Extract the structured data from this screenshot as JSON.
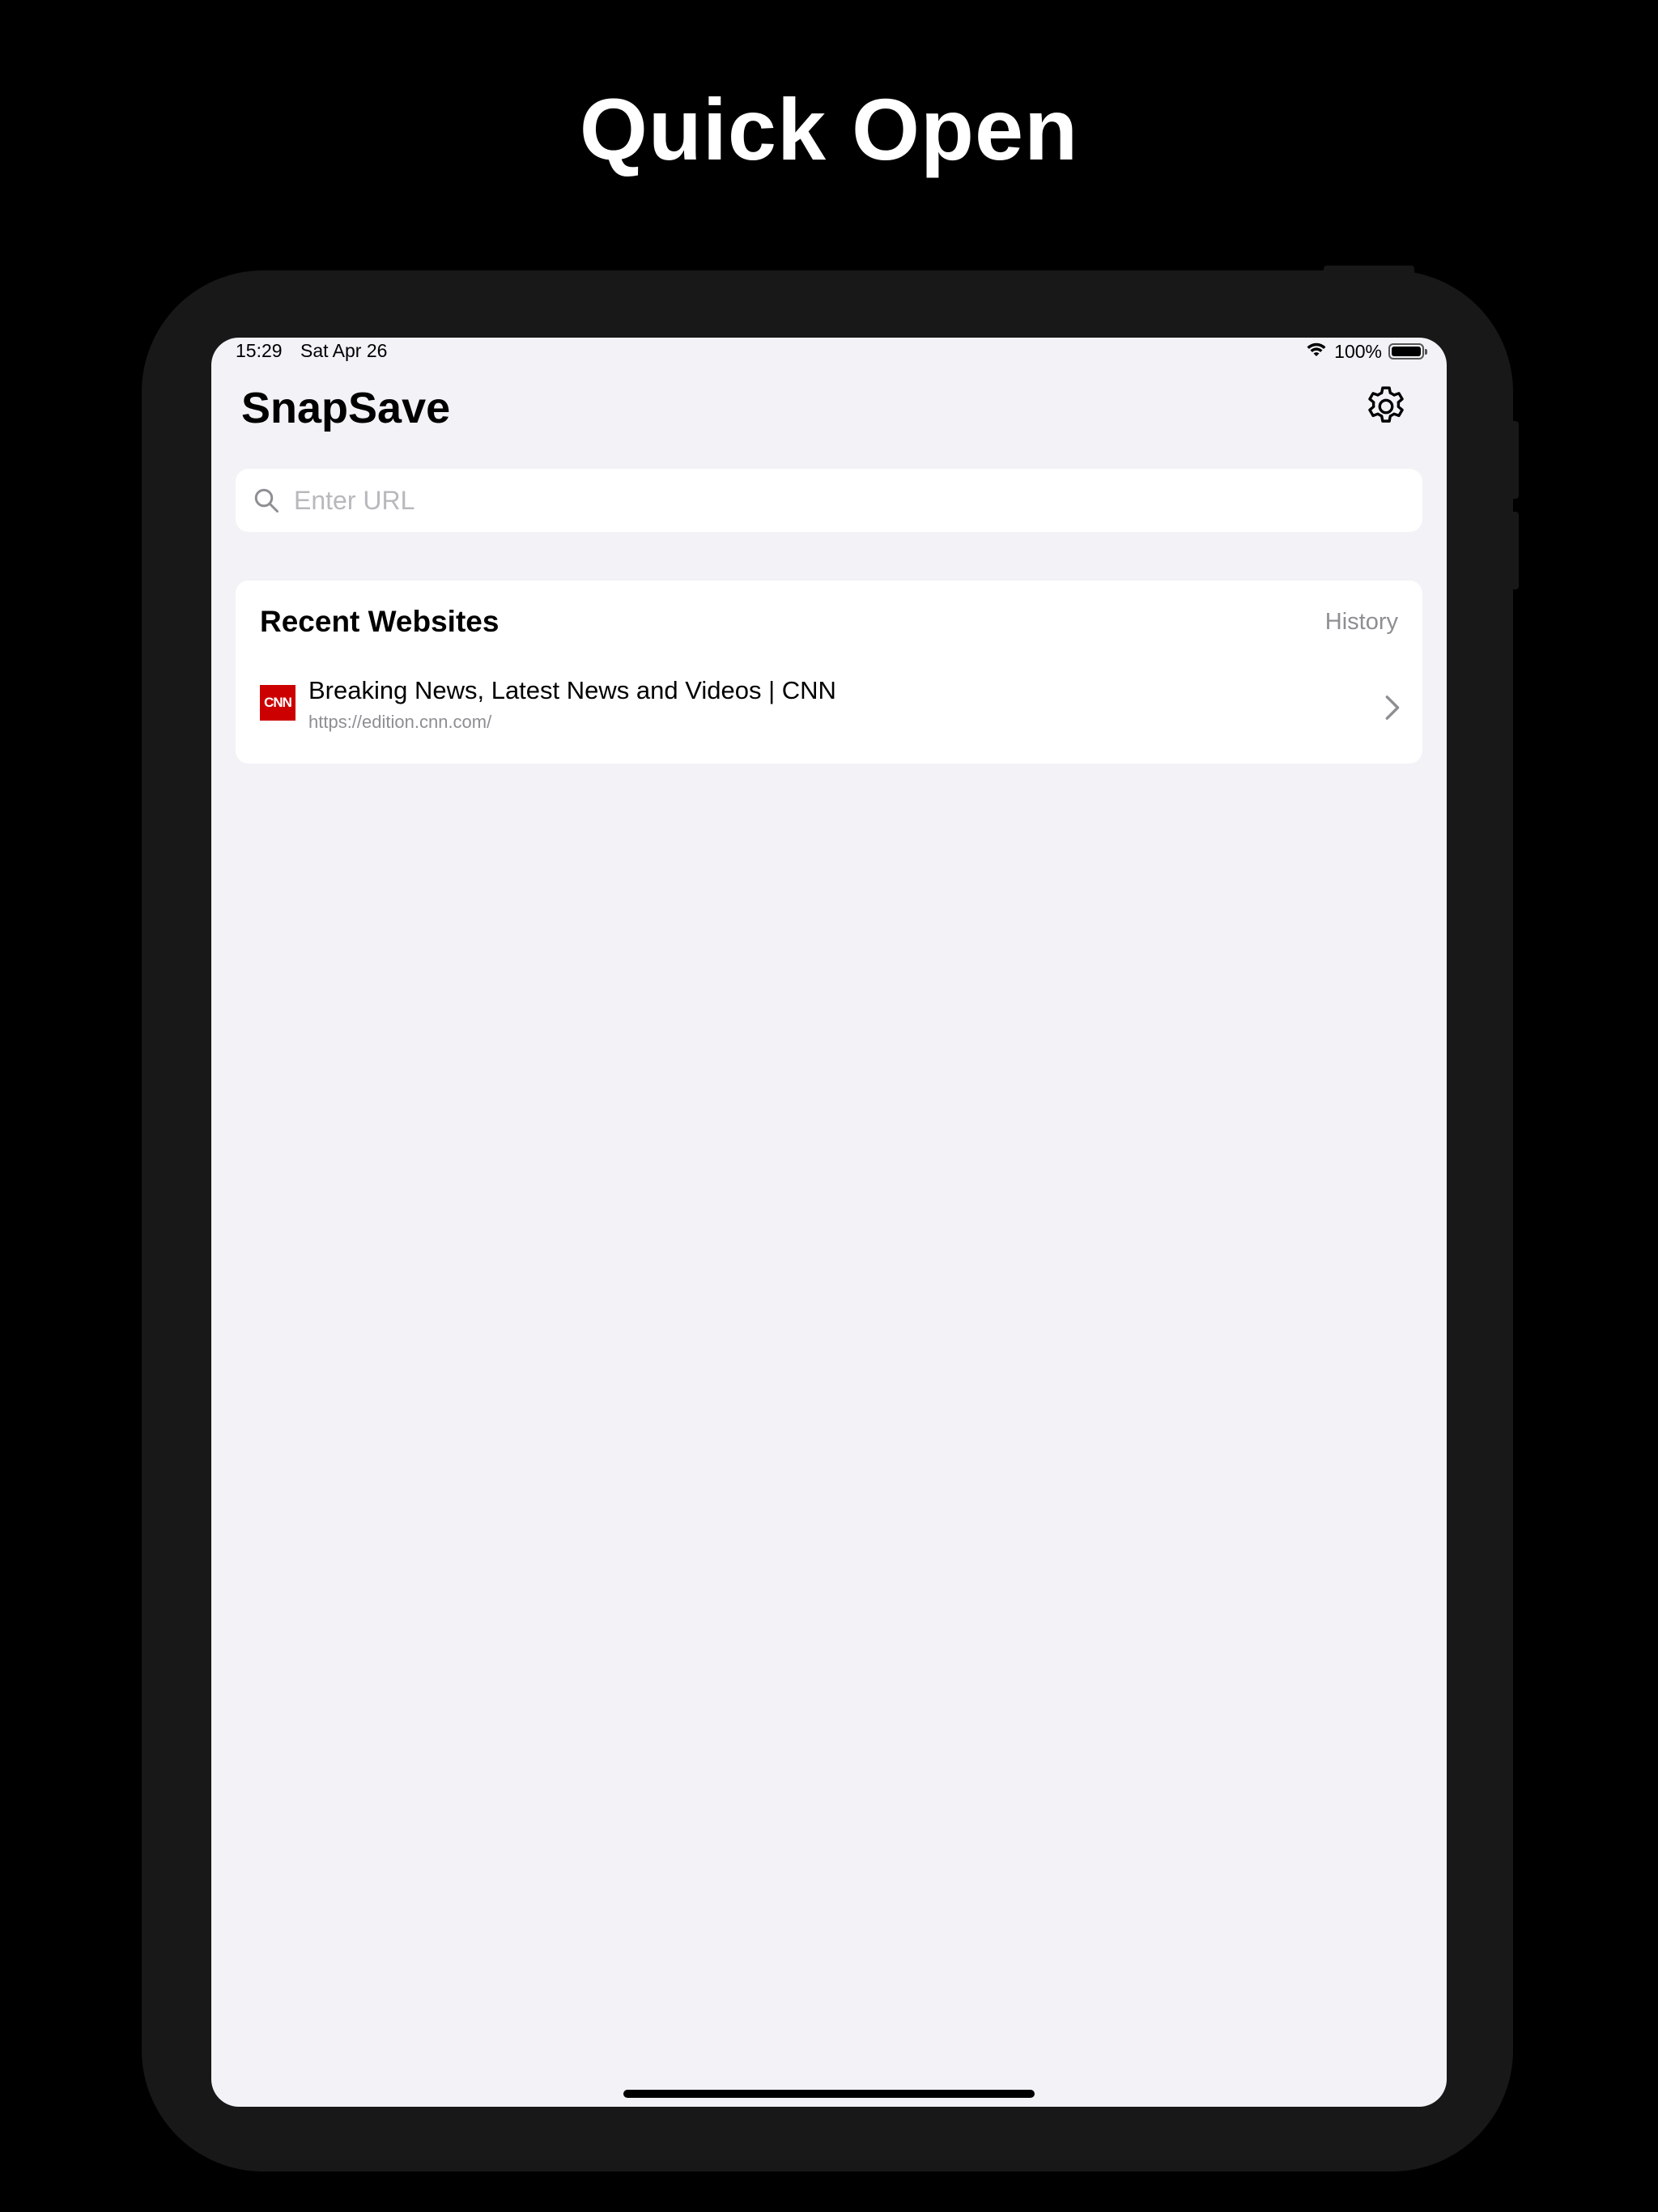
{
  "marketing": {
    "title": "Quick Open"
  },
  "status_bar": {
    "time": "15:29",
    "date": "Sat Apr 26",
    "battery": "100%",
    "wifi_icon": "wifi-icon",
    "battery_icon": "battery-icon"
  },
  "header": {
    "app_title": "SnapSave",
    "settings_icon": "gear-icon"
  },
  "search": {
    "placeholder": "Enter URL",
    "value": "",
    "icon": "search-icon"
  },
  "recent": {
    "title": "Recent Websites",
    "history_label": "History",
    "items": [
      {
        "title": "Breaking News, Latest News and Videos | CNN",
        "url": "https://edition.cnn.com/",
        "favicon_text": "CNN",
        "favicon_color": "#cc0000"
      }
    ]
  },
  "colors": {
    "background": "#000000",
    "device": "#181818",
    "screen": "#f2f2f7",
    "card": "#ffffff",
    "secondary_text": "#8e8e93"
  }
}
